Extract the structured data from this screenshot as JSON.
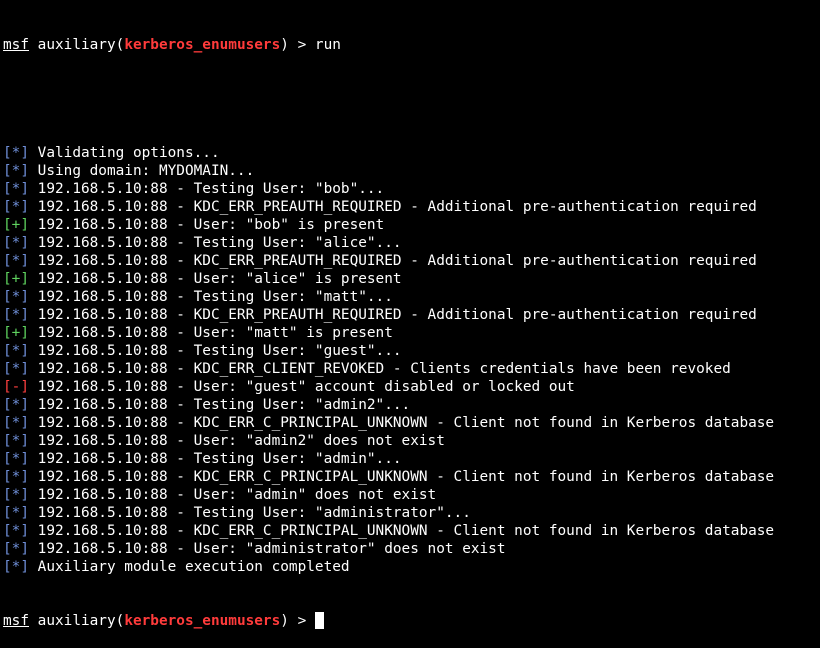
{
  "prompt": {
    "msf": "msf",
    "open": " auxiliary(",
    "module": "kerberos_enumusers",
    "close": ") > "
  },
  "command": "run",
  "lines": [
    {
      "tag": "[*]",
      "kind": "info",
      "text": " Validating options..."
    },
    {
      "tag": "[*]",
      "kind": "info",
      "text": " Using domain: MYDOMAIN..."
    },
    {
      "tag": "[*]",
      "kind": "info",
      "text": " 192.168.5.10:88 - Testing User: \"bob\"..."
    },
    {
      "tag": "[*]",
      "kind": "info",
      "text": " 192.168.5.10:88 - KDC_ERR_PREAUTH_REQUIRED - Additional pre-authentication required"
    },
    {
      "tag": "[+]",
      "kind": "good",
      "text": " 192.168.5.10:88 - User: \"bob\" is present"
    },
    {
      "tag": "[*]",
      "kind": "info",
      "text": " 192.168.5.10:88 - Testing User: \"alice\"..."
    },
    {
      "tag": "[*]",
      "kind": "info",
      "text": " 192.168.5.10:88 - KDC_ERR_PREAUTH_REQUIRED - Additional pre-authentication required"
    },
    {
      "tag": "[+]",
      "kind": "good",
      "text": " 192.168.5.10:88 - User: \"alice\" is present"
    },
    {
      "tag": "[*]",
      "kind": "info",
      "text": " 192.168.5.10:88 - Testing User: \"matt\"..."
    },
    {
      "tag": "[*]",
      "kind": "info",
      "text": " 192.168.5.10:88 - KDC_ERR_PREAUTH_REQUIRED - Additional pre-authentication required"
    },
    {
      "tag": "[+]",
      "kind": "good",
      "text": " 192.168.5.10:88 - User: \"matt\" is present"
    },
    {
      "tag": "[*]",
      "kind": "info",
      "text": " 192.168.5.10:88 - Testing User: \"guest\"..."
    },
    {
      "tag": "[*]",
      "kind": "info",
      "text": " 192.168.5.10:88 - KDC_ERR_CLIENT_REVOKED - Clients credentials have been revoked"
    },
    {
      "tag": "[-]",
      "kind": "bad",
      "text": " 192.168.5.10:88 - User: \"guest\" account disabled or locked out"
    },
    {
      "tag": "[*]",
      "kind": "info",
      "text": " 192.168.5.10:88 - Testing User: \"admin2\"..."
    },
    {
      "tag": "[*]",
      "kind": "info",
      "text": " 192.168.5.10:88 - KDC_ERR_C_PRINCIPAL_UNKNOWN - Client not found in Kerberos database"
    },
    {
      "tag": "[*]",
      "kind": "info",
      "text": " 192.168.5.10:88 - User: \"admin2\" does not exist"
    },
    {
      "tag": "[*]",
      "kind": "info",
      "text": " 192.168.5.10:88 - Testing User: \"admin\"..."
    },
    {
      "tag": "[*]",
      "kind": "info",
      "text": " 192.168.5.10:88 - KDC_ERR_C_PRINCIPAL_UNKNOWN - Client not found in Kerberos database"
    },
    {
      "tag": "[*]",
      "kind": "info",
      "text": " 192.168.5.10:88 - User: \"admin\" does not exist"
    },
    {
      "tag": "[*]",
      "kind": "info",
      "text": " 192.168.5.10:88 - Testing User: \"administrator\"..."
    },
    {
      "tag": "[*]",
      "kind": "info",
      "text": " 192.168.5.10:88 - KDC_ERR_C_PRINCIPAL_UNKNOWN - Client not found in Kerberos database"
    },
    {
      "tag": "[*]",
      "kind": "info",
      "text": " 192.168.5.10:88 - User: \"administrator\" does not exist"
    },
    {
      "tag": "[*]",
      "kind": "info",
      "text": " Auxiliary module execution completed"
    }
  ],
  "colors": {
    "background": "#000000",
    "text": "#ffffff",
    "module": "#ff3b3b",
    "info_tag": "#6f8fd8",
    "good_tag": "#5fd35f",
    "bad_tag": "#ff4040"
  }
}
